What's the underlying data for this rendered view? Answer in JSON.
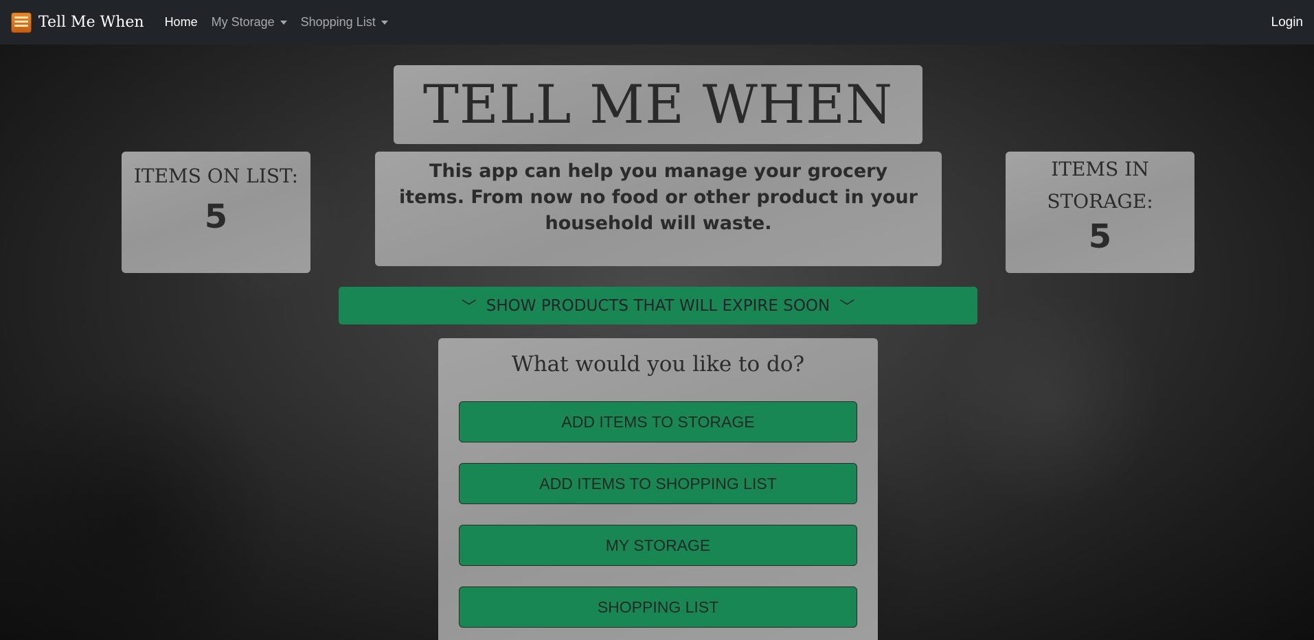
{
  "navbar": {
    "brand": "Tell Me When",
    "home": "Home",
    "my_storage": "My Storage",
    "shopping_list": "Shopping List",
    "login": "Login"
  },
  "hero": {
    "title": "TELL ME WHEN"
  },
  "stats": {
    "list_label": "ITEMS ON LIST:",
    "list_value": "5",
    "storage_label": "ITEMS IN STORAGE:",
    "storage_value": "5"
  },
  "description": "This app can help you manage your grocery items. From now no food or other product in your household will waste.",
  "expire_button": {
    "label": "SHOW PRODUCTS THAT WILL EXPIRE SOON",
    "icon": "chevron-down-icon"
  },
  "actions": {
    "title": "What would you like to do?",
    "buttons": [
      "ADD ITEMS TO STORAGE",
      "ADD ITEMS TO SHOPPING LIST",
      "MY STORAGE",
      "SHOPPING LIST"
    ]
  },
  "colors": {
    "navbar_bg": "#212529",
    "accent_green": "#198754",
    "panel_gray": "#9c9c9c"
  }
}
